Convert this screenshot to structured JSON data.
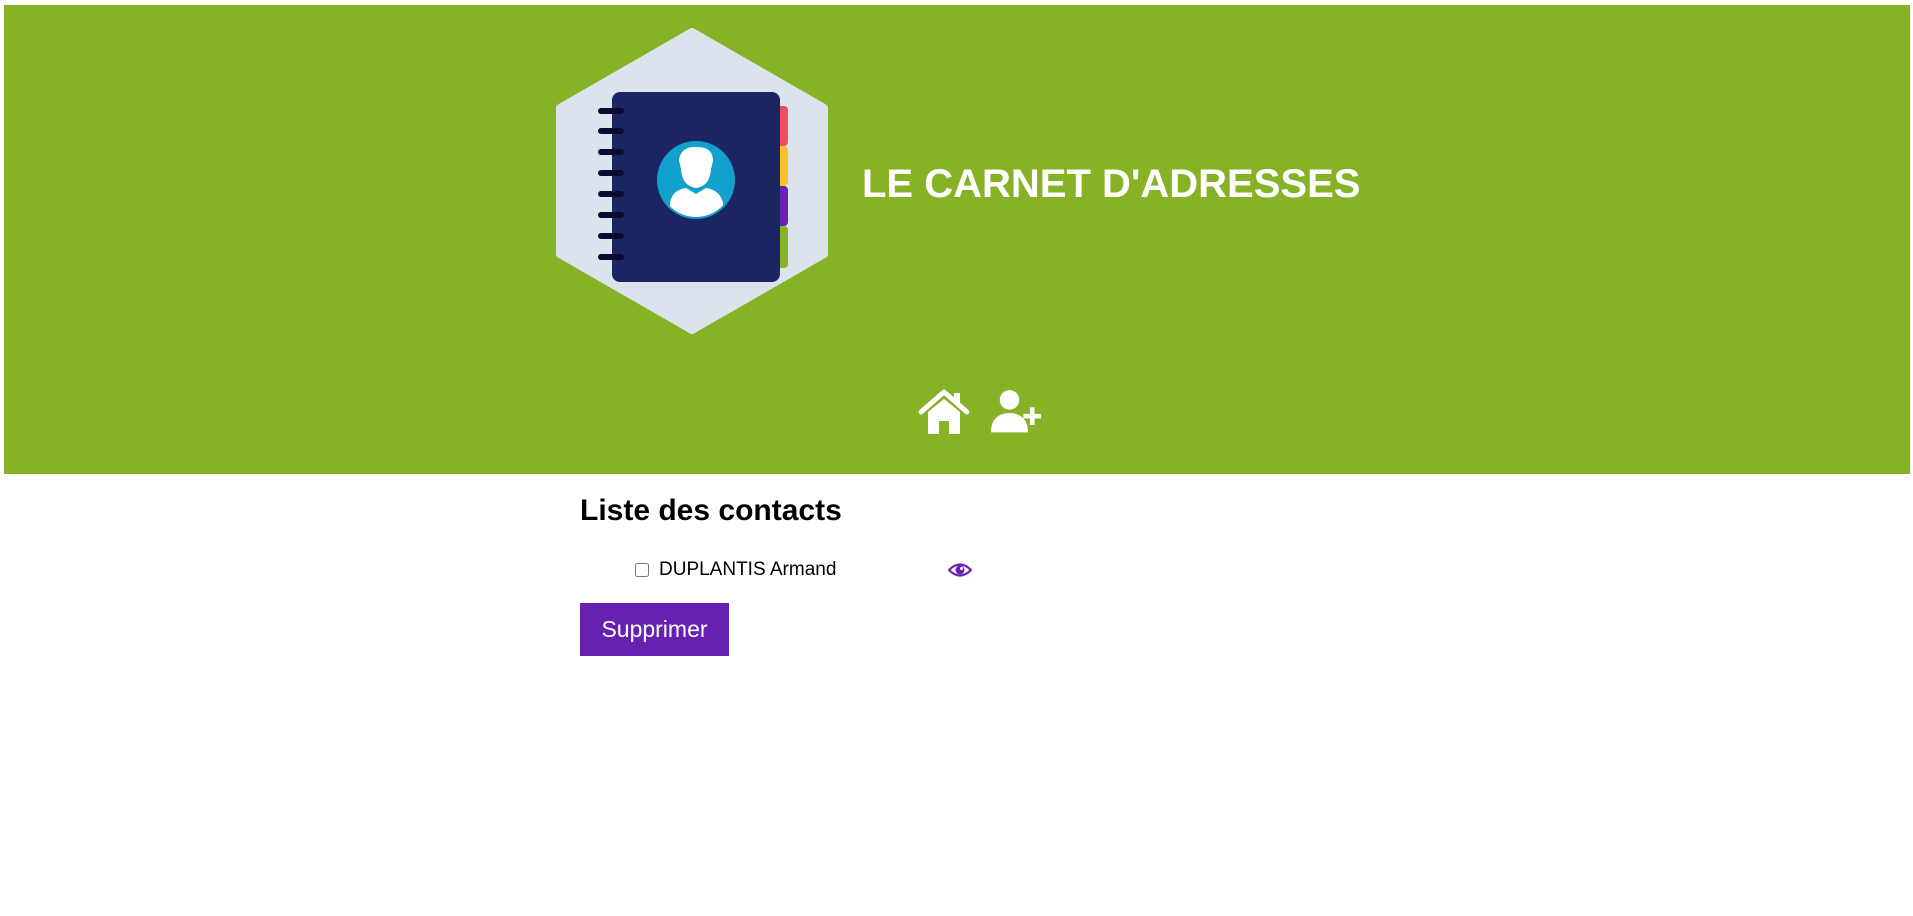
{
  "header": {
    "title": "LE CARNET D'ADRESSES",
    "logo_icon": "address-book-icon",
    "background_color": "#86b225"
  },
  "nav": {
    "items": [
      {
        "icon": "home-icon"
      },
      {
        "icon": "user-plus-icon"
      }
    ]
  },
  "main": {
    "section_title": "Liste des contacts",
    "contacts": [
      {
        "name": "DUPLANTIS Armand",
        "checked": false,
        "action_icon": "eye-icon"
      }
    ],
    "delete_button_label": "Supprimer",
    "accent_color": "#6721b1"
  }
}
